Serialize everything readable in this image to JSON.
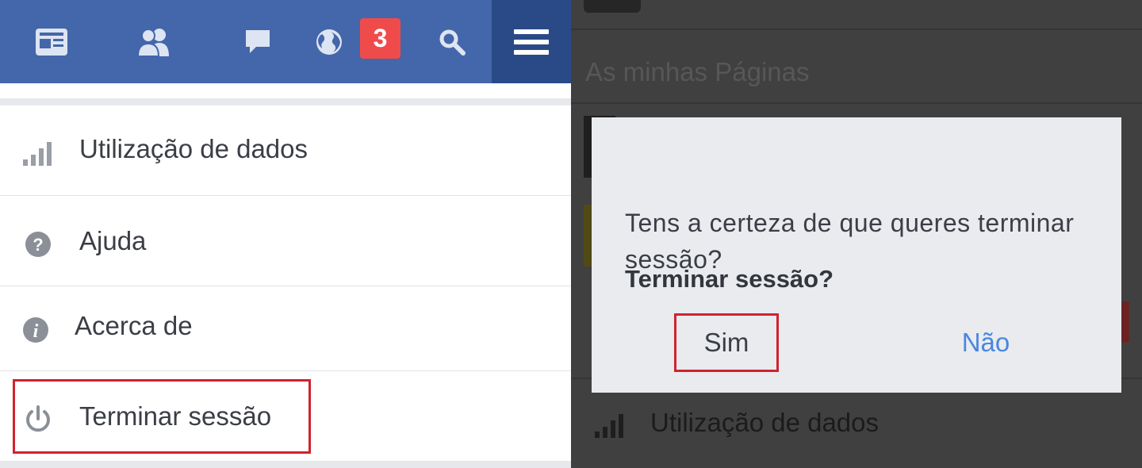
{
  "left_panel": {
    "notifications_badge": "3",
    "menu_items": [
      {
        "label": "Utilização de dados",
        "icon": "signal-bars-icon"
      },
      {
        "label": "Ajuda",
        "icon": "help-icon"
      },
      {
        "label": "Acerca de",
        "icon": "info-icon"
      },
      {
        "label": "Terminar sessão",
        "icon": "power-icon"
      }
    ]
  },
  "right_panel": {
    "section_heading": "As minhas Páginas",
    "background_row_label": "Utilização de dados",
    "dialog": {
      "title": "Terminar sessão?",
      "message": "Tens a certeza de que queres terminar sessão?",
      "confirm_label": "Sim",
      "cancel_label": "Não"
    }
  },
  "colors": {
    "top_bar": "#4466aa",
    "menu_button_active": "#2a4a87",
    "badge": "#f04b4b",
    "highlight": "#d0232e",
    "link_blue": "#4a86e0"
  }
}
